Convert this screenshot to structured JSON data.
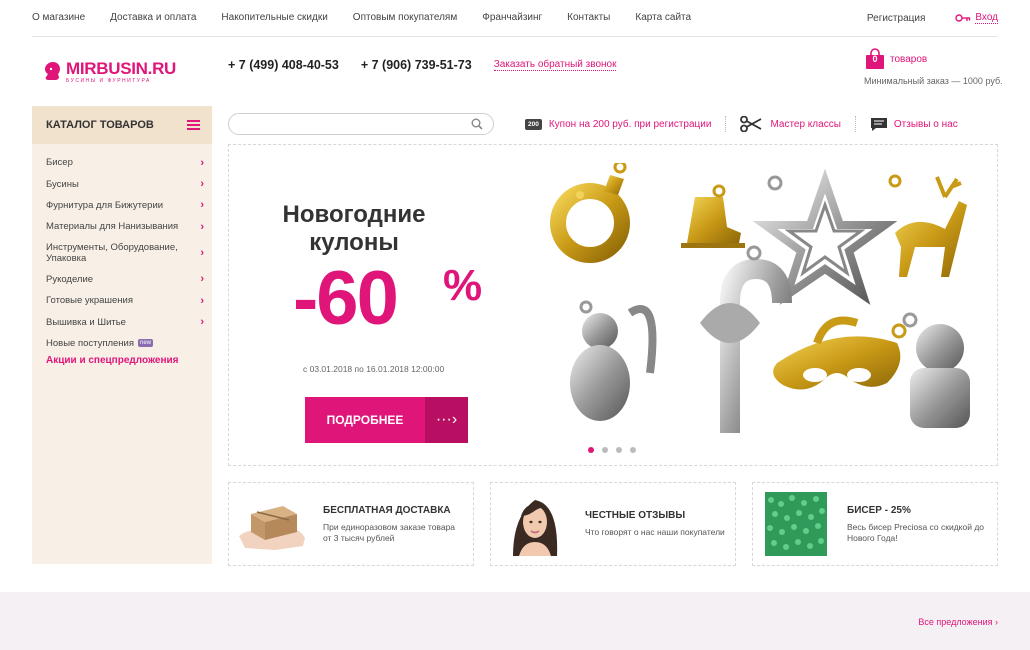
{
  "topnav": [
    {
      "label": "О магазине"
    },
    {
      "label": "Доставка и оплата"
    },
    {
      "label": "Накопительные скидки"
    },
    {
      "label": "Оптовым покупателям"
    },
    {
      "label": "Франчайзинг"
    },
    {
      "label": "Контакты"
    },
    {
      "label": "Карта сайта"
    }
  ],
  "account": {
    "register": "Регистрация",
    "login": "Вход",
    "login_icon": "key-icon"
  },
  "logo": {
    "name": "MIRBUSIN.RU",
    "subtitle": "БУСИНЫ И ФУРНИТУРА"
  },
  "header": {
    "phone1": "+ 7 (499) 408-40-53",
    "phone2": "+ 7 (906) 739-51-73",
    "callback": "Заказать обратный звонок"
  },
  "cart": {
    "count": "0",
    "label": "товаров",
    "min_order": "Минимальный заказ — 1000 руб."
  },
  "sidebar": {
    "title": "КАТАЛОГ ТОВАРОВ",
    "items": [
      {
        "label": "Бисер"
      },
      {
        "label": "Бусины"
      },
      {
        "label": "Фурнитура для Бижутерии"
      },
      {
        "label": "Материалы для Нанизывания"
      },
      {
        "label": "Инструменты, Оборудование, Упаковка"
      },
      {
        "label": "Рукоделие"
      },
      {
        "label": "Готовые украшения"
      },
      {
        "label": "Вышивка и Шитье"
      }
    ],
    "new_label": "Новые поступления",
    "new_badge": "new",
    "special": "Акции и спецпредложения"
  },
  "search": {
    "placeholder": "",
    "value": ""
  },
  "promos": {
    "coupon_tag": "200",
    "coupon": "Купон на 200 руб. при регистрации",
    "master": "Мастер классы",
    "reviews": "Отзывы о нас"
  },
  "banner": {
    "title": "Новогодние кулоны",
    "discount": "-60",
    "percent": "%",
    "dates": "с 03.01.2018 по 16.01.2018 12:00:00",
    "button": "ПОДРОБНЕЕ",
    "slides": 4,
    "active_slide": 1
  },
  "features": [
    {
      "title": "БЕСПЛАТНАЯ ДОСТАВКА",
      "desc": "При единоразовом заказе товара от 3 тысяч рублей"
    },
    {
      "title": "ЧЕСТНЫЕ ОТЗЫВЫ",
      "desc": "Что говорят о нас наши покупатели"
    },
    {
      "title": "БИСЕР - 25%",
      "desc": "Весь бисер Preciosa со скидкой до Нового Года!"
    }
  ],
  "footer": {
    "all_offers": "Все предложения"
  },
  "colors": {
    "accent": "#e0157a",
    "sidebar_bg": "#f8f0e6",
    "sidebar_head": "#f1e2cd"
  }
}
